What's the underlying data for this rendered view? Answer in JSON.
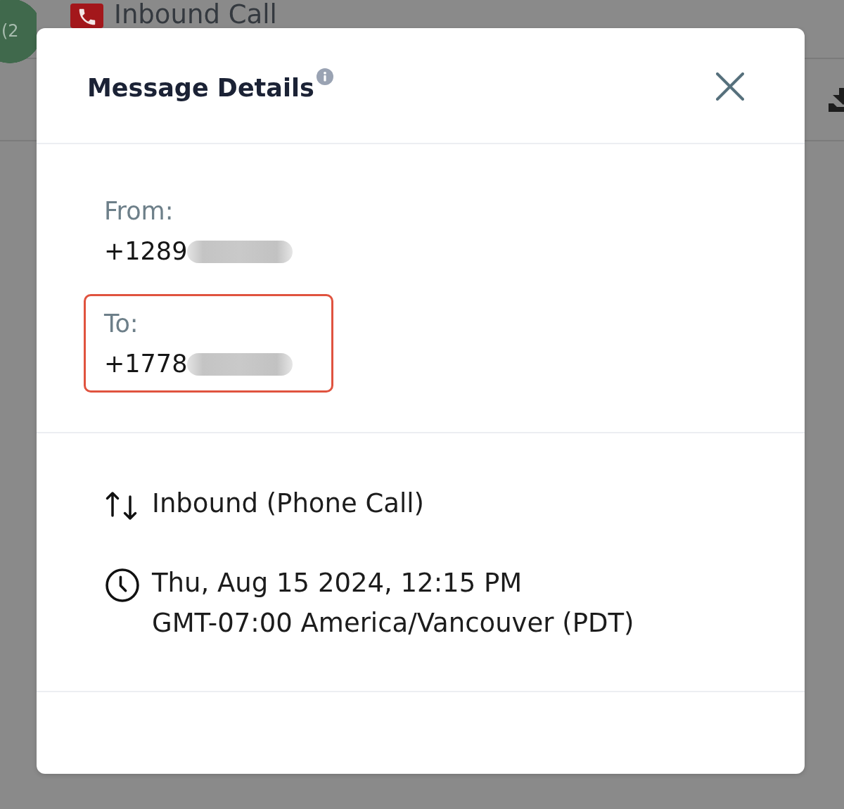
{
  "background": {
    "avatar_text": "(2",
    "title": "Inbound Call"
  },
  "dialog": {
    "title": "Message Details"
  },
  "fields": [
    {
      "label": "From:",
      "value": "+1289",
      "redacted": true,
      "highlighted": false
    },
    {
      "label": "To:",
      "value": "+1778",
      "redacted": true,
      "highlighted": true
    }
  ],
  "details": [
    {
      "kind": "direction",
      "lines": [
        "Inbound (Phone Call)"
      ]
    },
    {
      "kind": "time",
      "lines": [
        "Thu, Aug 15 2024, 12:15 PM",
        "GMT-07:00 America/Vancouver (PDT)"
      ]
    }
  ]
}
